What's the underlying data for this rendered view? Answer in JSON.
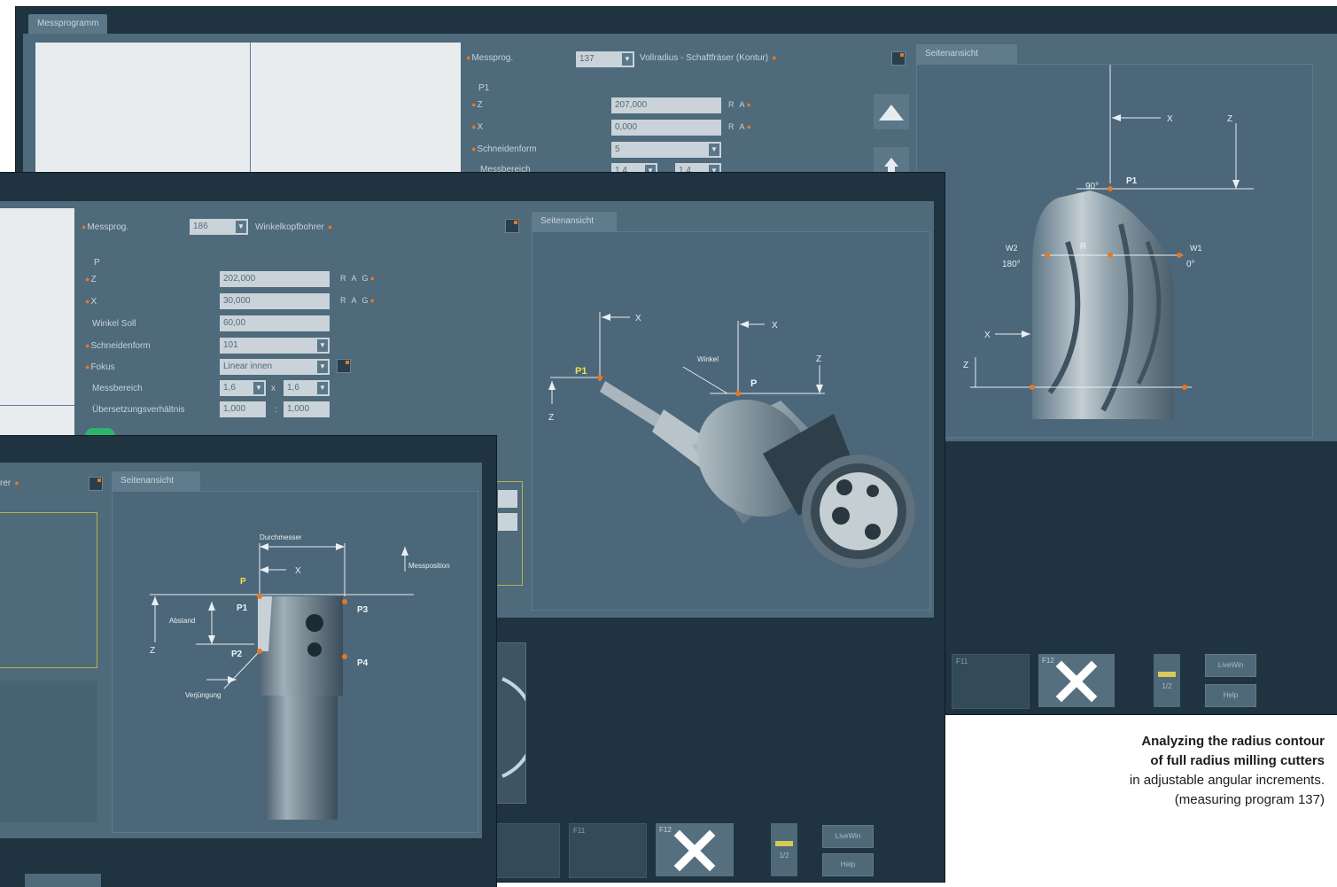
{
  "window_back": {
    "tab_label": "Messprogramm",
    "mp_label": "Messprog.",
    "mp_number": "137",
    "mp_name": "Vollradius - Schaftfräser (Kontur)",
    "point_label": "P1",
    "fields": [
      {
        "label": "Z",
        "value": "207,000",
        "unit": "R A"
      },
      {
        "label": "X",
        "value": "0,000",
        "unit": "R A"
      },
      {
        "label": "Schneidenform",
        "value": "5"
      },
      {
        "label": "Messbereich",
        "value": "1,4",
        "value2": "1,4"
      }
    ],
    "view_tab": "Seitenansicht",
    "view_labels": {
      "x": "X",
      "z": "Z",
      "p1": "P1",
      "angle_top": "90°",
      "w1": "W1",
      "w2": "W2",
      "angle_left": "180°",
      "angle_right": "0°",
      "r": "R",
      "x2": "X",
      "z2": "Z"
    },
    "fkeys": {
      "f11": "F11",
      "f12": "F12"
    },
    "pager": "1/2",
    "buttons": {
      "livewin": "LiveWin",
      "help": "Help"
    }
  },
  "window_mid": {
    "mp_label": "Messprog.",
    "mp_number": "186",
    "mp_name": "Winkelkopfbohrer",
    "point_label": "P",
    "fields": [
      {
        "label": "Z",
        "value": "202,000",
        "unit": "R A G"
      },
      {
        "label": "X",
        "value": "30,000",
        "unit": "R A G"
      },
      {
        "label": "Winkel Soll",
        "value": "60,00"
      },
      {
        "label": "Schneidenform",
        "value": "101"
      },
      {
        "label": "Fokus",
        "value": "Linear innen"
      },
      {
        "label": "Messbereich",
        "value": "1,6",
        "value2": "1,6"
      },
      {
        "label": "Übersetzungsverhältnis",
        "value": "1,000",
        "value2": "1,000"
      }
    ],
    "view_tab": "Seitenansicht",
    "view_labels": {
      "x1": "X",
      "x2": "X",
      "p1": "P1",
      "p": "P",
      "winkel": "Winkel",
      "z1": "Z",
      "z2": "Z"
    },
    "fkeys": {
      "f11": "F11",
      "f12": "F12"
    },
    "pager": "1/2",
    "buttons": {
      "livewin": "LiveWin",
      "help": "Help"
    }
  },
  "window_front": {
    "mp_name_tail": "rer",
    "view_tab": "Seitenansicht",
    "view_labels": {
      "durchmesser": "Durchmesser",
      "x": "X",
      "messposition": "Messposition",
      "p": "P",
      "p1": "P1",
      "p2": "P2",
      "p3": "P3",
      "p4": "P4",
      "abstand": "Abstand",
      "z": "Z",
      "verjungung": "Verjüngung"
    }
  },
  "caption": {
    "line1": "Analyzing the radius contour",
    "line2": "of full radius milling cutters",
    "line3": "in adjustable angular increments.",
    "line4": "(measuring program 137)"
  },
  "colors": {
    "window_bg": "#1f3340",
    "panel_bg": "#4e6a7b",
    "accent_orange": "#e87722",
    "highlight_yellow": "#f4e04d"
  }
}
